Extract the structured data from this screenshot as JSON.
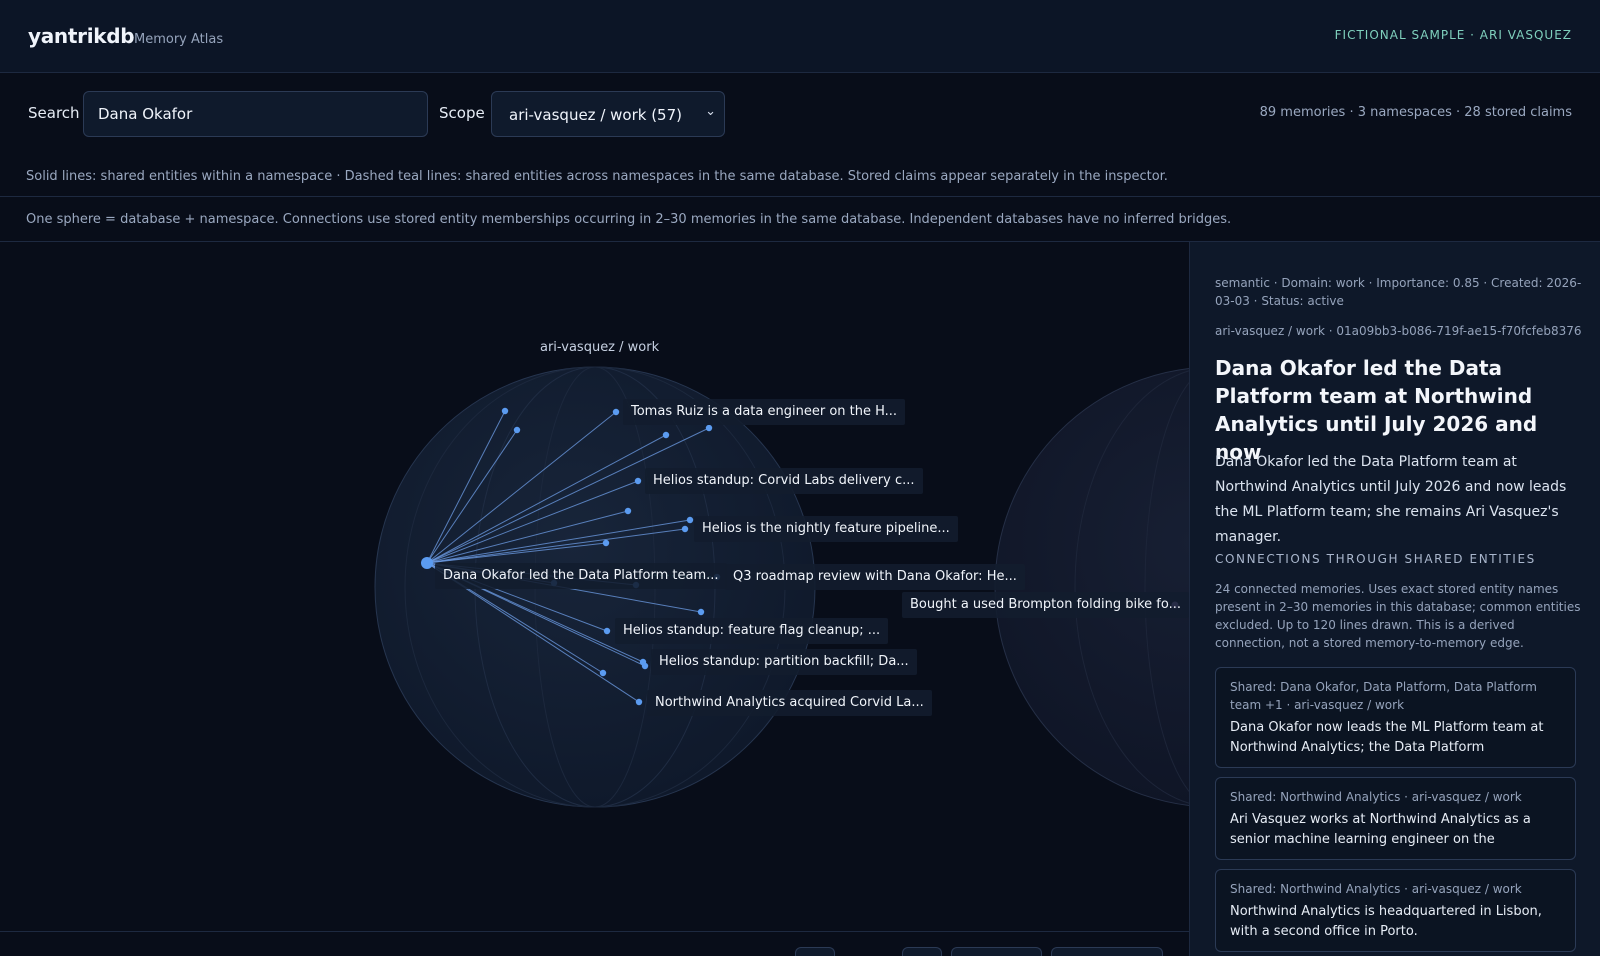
{
  "header": {
    "brand": "yantrikdb",
    "subtitle": "Memory Atlas",
    "sample_tag": "FICTIONAL SAMPLE · ARI VASQUEZ"
  },
  "controls": {
    "search_label": "Search",
    "search_value": "Dana Okafor",
    "scope_label": "Scope",
    "scope_value": "ari-vasquez / work (57)",
    "stats": "89 memories · 3 namespaces · 28 stored claims"
  },
  "legend": "Solid lines: shared entities within a namespace · Dashed teal lines: shared entities across namespaces in the same database. Stored claims appear separately in the inspector.",
  "explanation": "One sphere = database + namespace. Connections use stored entity memberships occurring in 2–30 memories in the same database. Independent databases have no inferred bridges.",
  "graph": {
    "sphere_title": "ari-vasquez / work",
    "selected_label": "Dana Okafor led the Data Platform team...",
    "node_labels": [
      "Tomas Ruiz is a data engineer on the H...",
      "Helios standup: Corvid Labs delivery c...",
      "Helios is the nightly feature pipeline...",
      "Q3 roadmap review with Dana Okafor: He...",
      "Helios standup: feature flag cleanup; ...",
      "Helios standup: partition backfill; Da...",
      "Northwind Analytics acquired Corvid La..."
    ],
    "other_sphere_label": "Bought a used Brompton folding bike fo...",
    "colors": {
      "node": "#5b9bf0",
      "edge": "#6f9fe8",
      "cross_edge": "#4fc3b0",
      "other_node": "#b89cf0"
    }
  },
  "inspector": {
    "meta": "semantic · Domain: work · Importance: 0.85 · Created: 2026-03-03 · Status: active",
    "id_line": "ari-vasquez / work · 01a09bb3-b086-719f-ae15-f70fcfeb8376",
    "title": "Dana Okafor led the Data Platform team at Northwind Analytics until July 2026 and now",
    "body": "Dana Okafor led the Data Platform team at Northwind Analytics until July 2026 and now leads the ML Platform team; she remains Ari Vasquez's manager.",
    "connections_heading": "CONNECTIONS THROUGH SHARED ENTITIES",
    "connections_desc": "24 connected memories. Uses exact stored entity names present in 2–30 memories in this database; common entities excluded. Up to 120 lines drawn. This is a derived connection, not a stored memory-to-memory edge.",
    "cards": [
      {
        "meta": "Shared: Dana Okafor, Data Platform, Data Platform team +1 · ari-vasquez / work",
        "text": "Dana Okafor now leads the ML Platform team at Northwind Analytics; the Data Platform"
      },
      {
        "meta": "Shared: Northwind Analytics · ari-vasquez / work",
        "text": "Ari Vasquez works at Northwind Analytics as a senior machine learning engineer on the"
      },
      {
        "meta": "Shared: Northwind Analytics · ari-vasquez / work",
        "text": "Northwind Analytics is headquartered in Lisbon, with a second office in Porto."
      }
    ]
  }
}
